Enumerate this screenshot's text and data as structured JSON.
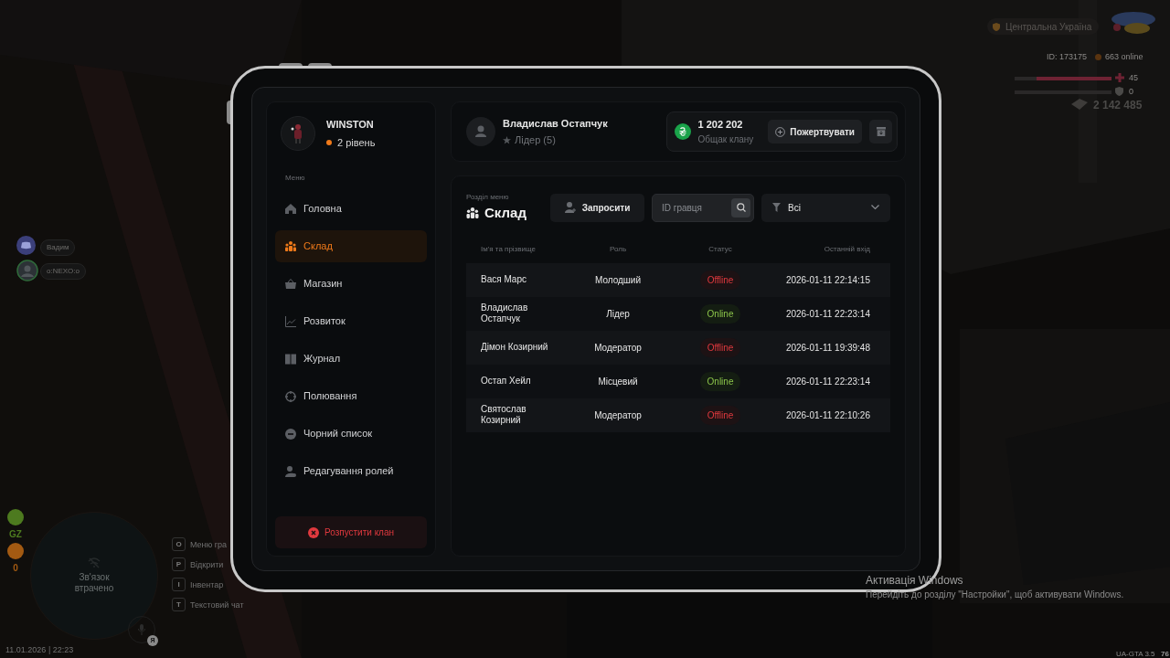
{
  "hud": {
    "region": "Центральна Україна",
    "player_id": "ID: 173175",
    "online": "663 online",
    "health": {
      "reading": "45",
      "level": 0.77
    },
    "armor": {
      "reading": "0",
      "level": 0
    },
    "money": "2 142 485",
    "voice_users": [
      {
        "kind": "discord",
        "name": "Вадим"
      },
      {
        "kind": "avatar",
        "name": "o:NEXO:o"
      }
    ],
    "indicators": [
      {
        "label": "GZ",
        "color": "#4d7a1f"
      },
      {
        "label": "0",
        "color": "#a35a12"
      }
    ],
    "minimap_status": "Зв'язок втрачено",
    "hotkeys": [
      {
        "key": "O",
        "label": "Меню гра"
      },
      {
        "key": "P",
        "label": "Відкрити"
      },
      {
        "key": "I",
        "label": "Інвентар"
      },
      {
        "key": "T",
        "label": "Текстовий чат"
      }
    ],
    "mic_key": "Я",
    "datetime": "11.01.2026 | 22:23",
    "version": "UA-GTA 3.5",
    "fps": "76"
  },
  "os_notice": {
    "title": "Активація Windows",
    "text": "Перейдіть до розділу \"Настройки\", щоб активувати Windows."
  },
  "tablet": {
    "profile": {
      "name": "WINSTON",
      "level": "2 рівень"
    },
    "menu_heading": "Меню",
    "menu": [
      {
        "label": "Головна",
        "selected": false
      },
      {
        "label": "Склад",
        "selected": true
      },
      {
        "label": "Магазин",
        "selected": false
      },
      {
        "label": "Розвиток",
        "selected": false
      },
      {
        "label": "Журнал",
        "selected": false
      },
      {
        "label": "Полювання",
        "selected": false
      },
      {
        "label": "Чорний список",
        "selected": false
      },
      {
        "label": "Редагування ролей",
        "selected": false
      }
    ],
    "disband_button": "Розпустити клан",
    "leader": {
      "name": "Владислав Остапчук",
      "role": "Лідер (5)"
    },
    "treasury": {
      "amount": "1 202 202",
      "label": "Общак клану"
    },
    "donate_button": "Пожертвувати",
    "section_caption": "Розділ меню",
    "section_title": "Склад",
    "invite_button": "Запросити",
    "search": {
      "placeholder": "ID гравця"
    },
    "filter": {
      "value": "Всі"
    },
    "table": {
      "columns": [
        "Ім'я та прізвище",
        "Роль",
        "Статус",
        "Останній вхід"
      ],
      "rows": [
        {
          "name": "Вася Марс",
          "role": "Молодший",
          "status": "Offline",
          "online": false,
          "last_login": "2026-01-11 22:14:15"
        },
        {
          "name": "Владислав Остапчук",
          "role": "Лідер",
          "status": "Online",
          "online": true,
          "last_login": "2026-01-11 22:23:14"
        },
        {
          "name": "Дімон Козирний",
          "role": "Модератор",
          "status": "Offline",
          "online": false,
          "last_login": "2026-01-11 19:39:48"
        },
        {
          "name": "Остап Хейл",
          "role": "Місцевий",
          "status": "Online",
          "online": true,
          "last_login": "2026-01-11 22:23:14"
        },
        {
          "name": "Святослав Козирний",
          "role": "Модератор",
          "status": "Offline",
          "online": false,
          "last_login": "2026-01-11 22:10:26"
        }
      ]
    }
  }
}
